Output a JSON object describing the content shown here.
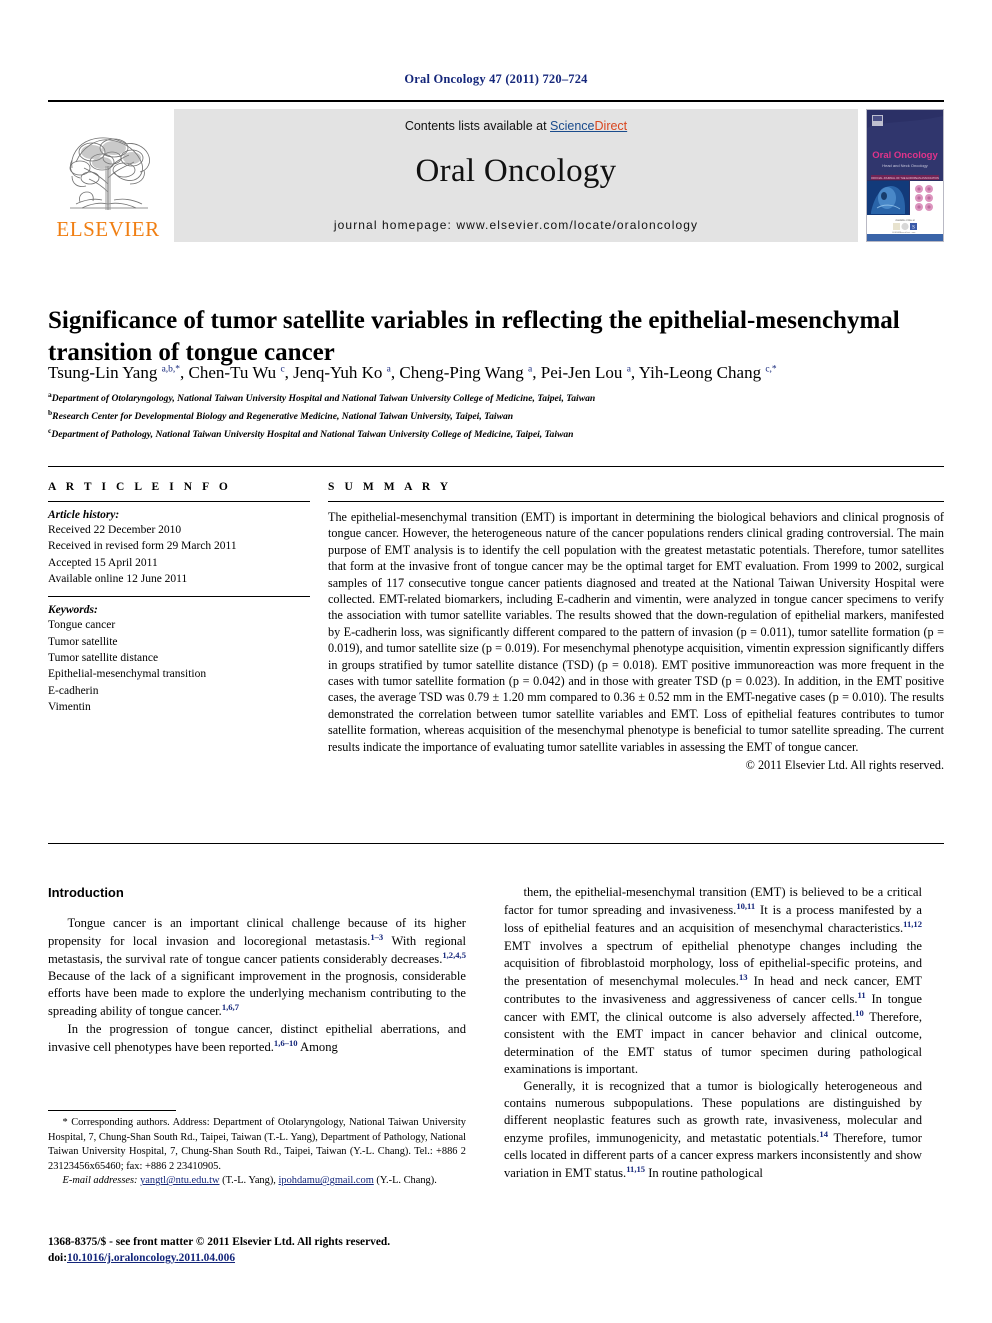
{
  "running_head": "Oral Oncology 47 (2011) 720–724",
  "masthead": {
    "publisher": "ELSEVIER",
    "contents_prefix": "Contents lists available at ",
    "contents_link_science": "Science",
    "contents_link_direct": "Direct",
    "journal_title": "Oral Oncology",
    "homepage": "journal homepage: www.elsevier.com/locate/oraloncology",
    "cover_title": "Oral Oncology",
    "cover_subtitle": "Head and Neck Oncology"
  },
  "article": {
    "title": "Significance of tumor satellite variables in reflecting the epithelial-mesenchymal transition of tongue cancer",
    "authors_html": "Tsung-Lin Yang <sup>a,b,</sup><sup class=\"star\">*</sup>, Chen-Tu Wu <sup>c</sup>, Jenq-Yuh Ko <sup>a</sup>, Cheng-Ping Wang <sup>a</sup>, Pei-Jen Lou <sup>a</sup>, Yih-Leong Chang <sup>c,</sup><sup class=\"star\">*</sup>",
    "affiliations": [
      {
        "marker": "a",
        "text": "Department of Otolaryngology, National Taiwan University Hospital and National Taiwan University College of Medicine, Taipei, Taiwan"
      },
      {
        "marker": "b",
        "text": "Research Center for Developmental Biology and Regenerative Medicine, National Taiwan University, Taipei, Taiwan"
      },
      {
        "marker": "c",
        "text": "Department of Pathology, National Taiwan University Hospital and National Taiwan University College of Medicine, Taipei, Taiwan"
      }
    ]
  },
  "article_info": {
    "heading": "A R T I C L E    I N F O",
    "history_label": "Article history:",
    "history": [
      "Received 22 December 2010",
      "Received in revised form 29 March 2011",
      "Accepted 15 April 2011",
      "Available online 12 June 2011"
    ],
    "keywords_label": "Keywords:",
    "keywords": [
      "Tongue cancer",
      "Tumor satellite",
      "Tumor satellite distance",
      "Epithelial-mesenchymal transition",
      "E-cadherin",
      "Vimentin"
    ]
  },
  "summary": {
    "heading": "S U M M A R Y",
    "text": "The epithelial-mesenchymal transition (EMT) is important in determining the biological behaviors and clinical prognosis of tongue cancer. However, the heterogeneous nature of the cancer populations renders clinical grading controversial. The main purpose of EMT analysis is to identify the cell population with the greatest metastatic potentials. Therefore, tumor satellites that form at the invasive front of tongue cancer may be the optimal target for EMT evaluation. From 1999 to 2002, surgical samples of 117 consecutive tongue cancer patients diagnosed and treated at the National Taiwan University Hospital were collected. EMT-related biomarkers, including E-cadherin and vimentin, were analyzed in tongue cancer specimens to verify the association with tumor satellite variables. The results showed that the down-regulation of epithelial markers, manifested by E-cadherin loss, was significantly different compared to the pattern of invasion (p = 0.011), tumor satellite formation (p = 0.019), and tumor satellite size (p = 0.019). For mesenchymal phenotype acquisition, vimentin expression significantly differs in groups stratified by tumor satellite distance (TSD) (p = 0.018). EMT positive immunoreaction was more frequent in the cases with tumor satellite formation (p = 0.042) and in those with greater TSD (p = 0.023). In addition, in the EMT positive cases, the average TSD was 0.79 ± 1.20 mm compared to 0.36 ± 0.52 mm in the EMT-negative cases (p = 0.010). The results demonstrated the correlation between tumor satellite variables and EMT. Loss of epithelial features contributes to tumor satellite formation, whereas acquisition of the mesenchymal phenotype is beneficial to tumor satellite spreading. The current results indicate the importance of evaluating tumor satellite variables in assessing the EMT of tongue cancer.",
    "copyright": "© 2011 Elsevier Ltd. All rights reserved."
  },
  "body": {
    "intro_heading": "Introduction",
    "left_paragraphs_html": [
      "Tongue cancer is an important clinical challenge because of its higher propensity for local invasion and locoregional metastasis.<sup>1–3</sup> With regional metastasis, the survival rate of tongue cancer patients considerably decreases.<sup>1,2,4,5</sup> Because of the lack of a significant improvement in the prognosis, considerable efforts have been made to explore the underlying mechanism contributing to the spreading ability of tongue cancer.<sup>1,6,7</sup>",
      "In the progression of tongue cancer, distinct epithelial aberrations, and invasive cell phenotypes have been reported.<sup>1,6–10</sup> Among"
    ],
    "right_paragraphs_html": [
      "them, the epithelial-mesenchymal transition (EMT) is believed to be a critical factor for tumor spreading and invasiveness.<sup>10,11</sup> It is a process manifested by a loss of epithelial features and an acquisition of mesenchymal characteristics.<sup>11,12</sup> EMT involves a spectrum of epithelial phenotype changes including the acquisition of fibroblastoid morphology, loss of epithelial-specific proteins, and the presentation of mesenchymal molecules.<sup>13</sup> In head and neck cancer, EMT contributes to the invasiveness and aggressiveness of cancer cells.<sup>11</sup> In tongue cancer with EMT, the clinical outcome is also adversely affected.<sup>10</sup> Therefore, consistent with the EMT impact in cancer behavior and clinical outcome, determination of the EMT status of tumor specimen during pathological examinations is important.",
      "Generally, it is recognized that a tumor is biologically heterogeneous and contains numerous subpopulations. These populations are distinguished by different neoplastic features such as growth rate, invasiveness, molecular and enzyme profiles, immunogenicity, and metastatic potentials.<sup>14</sup> Therefore, tumor cells located in different parts of a cancer express markers inconsistently and show variation in EMT status.<sup>11,15</sup> In routine pathological"
    ]
  },
  "footnotes": {
    "corresponding_html": "* Corresponding authors. Address: Department of Otolaryngology, National Taiwan University Hospital, 7, Chung-Shan South Rd., Taipei, Taiwan (T.-L. Yang), Department of Pathology, National Taiwan University Hospital, 7, Chung-Shan South Rd., Taipei, Taiwan (Y.-L. Chang). Tel.: +886 2 23123456x65460; fax: +886 2 23410905.",
    "email_label": "E-mail addresses:",
    "email_1": "yangtl@ntu.edu.tw",
    "email_1_owner": "(T.-L. Yang),",
    "email_2": "ipohdamu@gmail.com",
    "email_2_owner": "(Y.-L. Chang)."
  },
  "imprint": {
    "line1": "1368-8375/$ - see front matter © 2011 Elsevier Ltd. All rights reserved.",
    "doi_label": "doi:",
    "doi_value": "10.1016/j.oraloncology.2011.04.006"
  },
  "colors": {
    "running_head": "#14267a",
    "elsevier_orange": "#f07f13",
    "sciencedirect_blue": "#1a4b8c",
    "sciencedirect_red": "#d9461e",
    "banner_gray": "#e3e3e3",
    "cover_navy": "#2a2f63",
    "cover_magenta": "#e0348a",
    "link_blue": "#14267a"
  }
}
